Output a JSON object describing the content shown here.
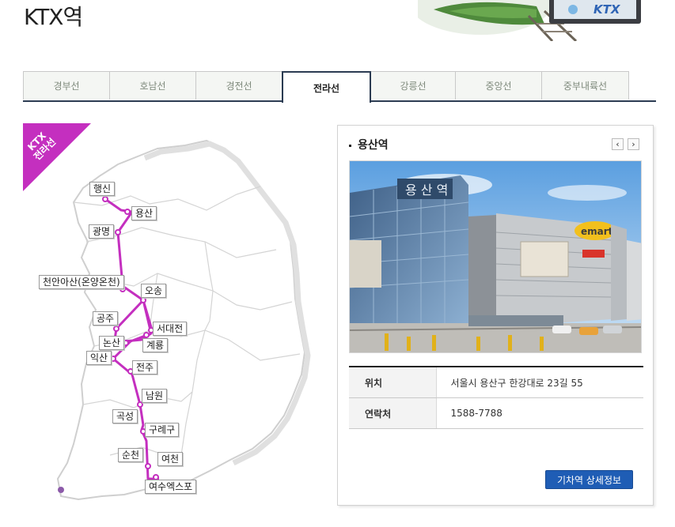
{
  "page": {
    "title": "KTX역"
  },
  "header": {
    "logo_text": "KTX"
  },
  "tabs": [
    {
      "label": "경부선",
      "active": false
    },
    {
      "label": "호남선",
      "active": false
    },
    {
      "label": "경전선",
      "active": false
    },
    {
      "label": "전라선",
      "active": true
    },
    {
      "label": "강릉선",
      "active": false
    },
    {
      "label": "중앙선",
      "active": false
    },
    {
      "label": "중부내륙선",
      "active": false
    }
  ],
  "map": {
    "badge_line1": "KTX",
    "badge_line2": "전라선",
    "line_color": "#c42fbf",
    "stations": [
      "행신",
      "용산",
      "광명",
      "천안아산(온양온천)",
      "오송",
      "공주",
      "서대전",
      "논산",
      "계룡",
      "익산",
      "전주",
      "남원",
      "곡성",
      "구례구",
      "순천",
      "여천",
      "여수엑스포"
    ]
  },
  "station_panel": {
    "name": "용산역",
    "prev_icon": "‹",
    "next_icon": "›",
    "photo_sign_text": "emart",
    "rows": [
      {
        "label": "위치",
        "value": "서울시 용산구 한강대로 23길 55"
      },
      {
        "label": "연락처",
        "value": "1588-7788"
      }
    ],
    "detail_button": "기차역 상세정보"
  }
}
